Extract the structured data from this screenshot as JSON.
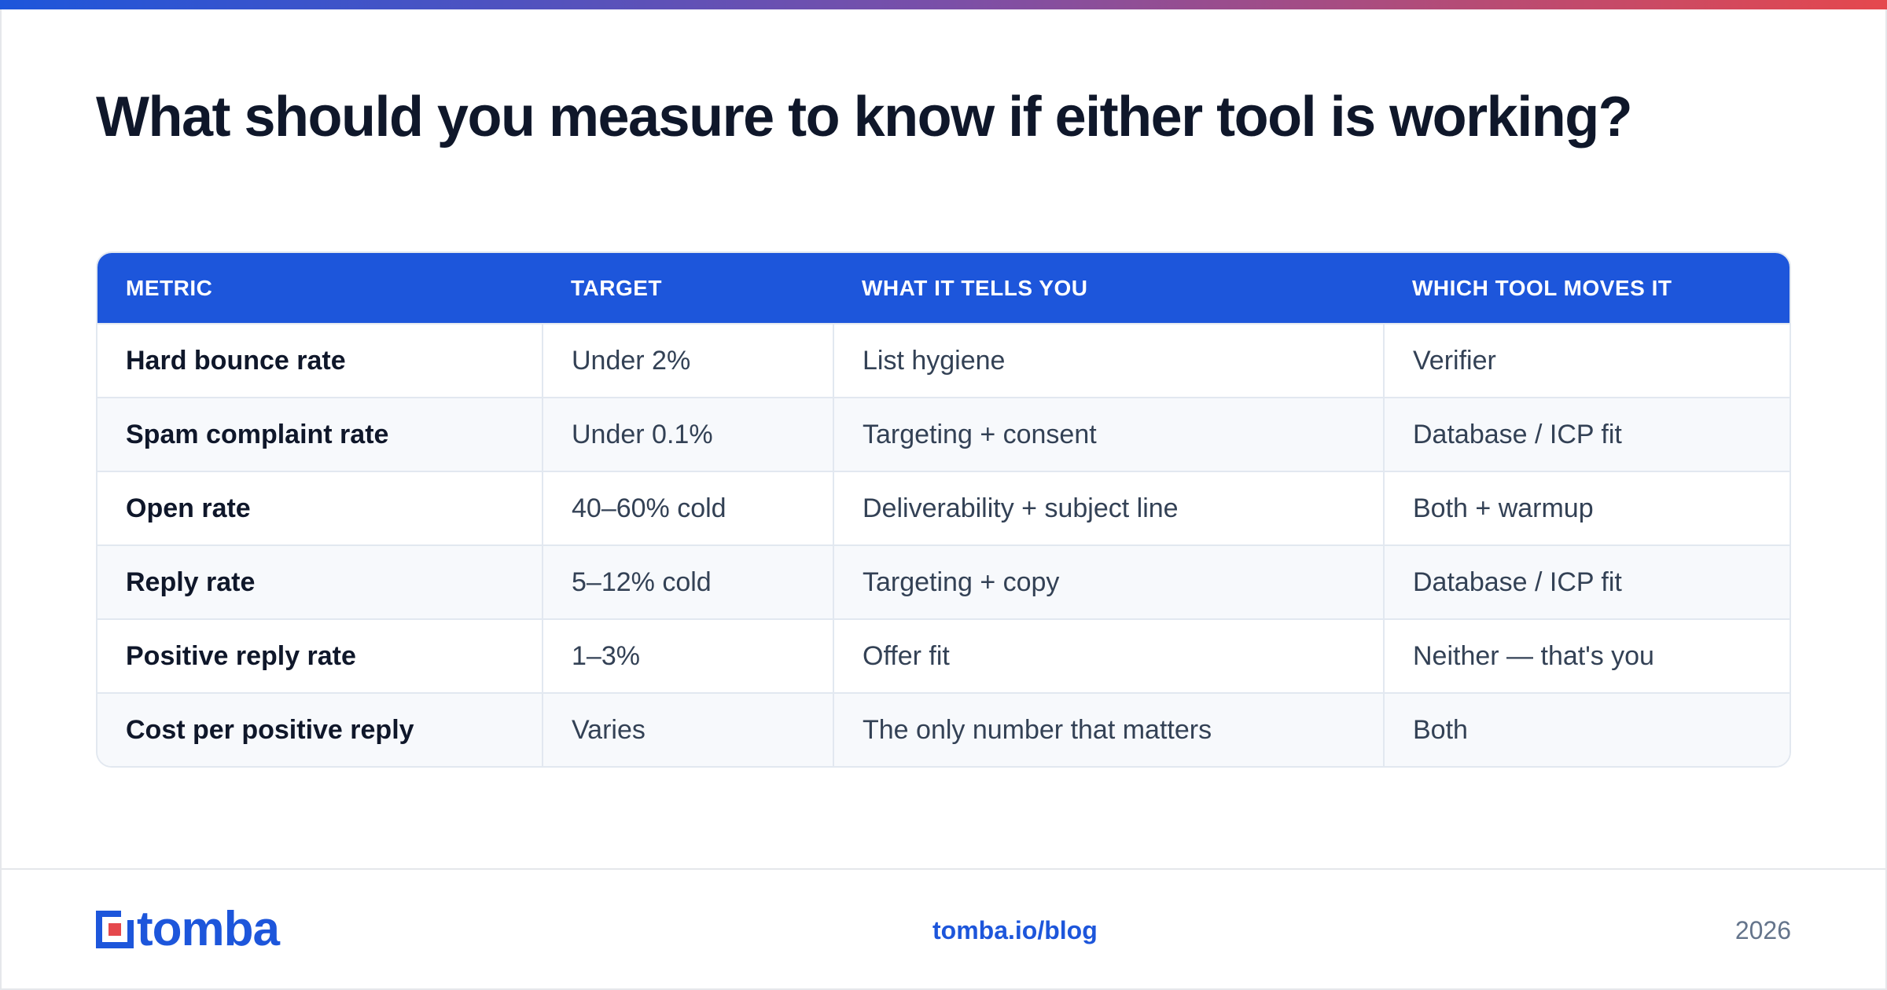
{
  "title": "What should you measure to know if either tool is working?",
  "table": {
    "headers": [
      "METRIC",
      "TARGET",
      "WHAT IT TELLS YOU",
      "WHICH TOOL MOVES IT"
    ],
    "rows": [
      [
        "Hard bounce rate",
        "Under 2%",
        "List hygiene",
        "Verifier"
      ],
      [
        "Spam complaint rate",
        "Under 0.1%",
        "Targeting + consent",
        "Database / ICP fit"
      ],
      [
        "Open rate",
        "40–60% cold",
        "Deliverability + subject line",
        "Both + warmup"
      ],
      [
        "Reply rate",
        "5–12% cold",
        "Targeting + copy",
        "Database / ICP fit"
      ],
      [
        "Positive reply rate",
        "1–3%",
        "Offer fit",
        "Neither — that's you"
      ],
      [
        "Cost per positive reply",
        "Varies",
        "The only number that matters",
        "Both"
      ]
    ]
  },
  "footer": {
    "logo_text": "tomba",
    "site": "tomba.io/blog",
    "year": "2026"
  },
  "colors": {
    "brand_blue": "#1d56db",
    "brand_red": "#e5484d",
    "title": "#0f172a"
  }
}
